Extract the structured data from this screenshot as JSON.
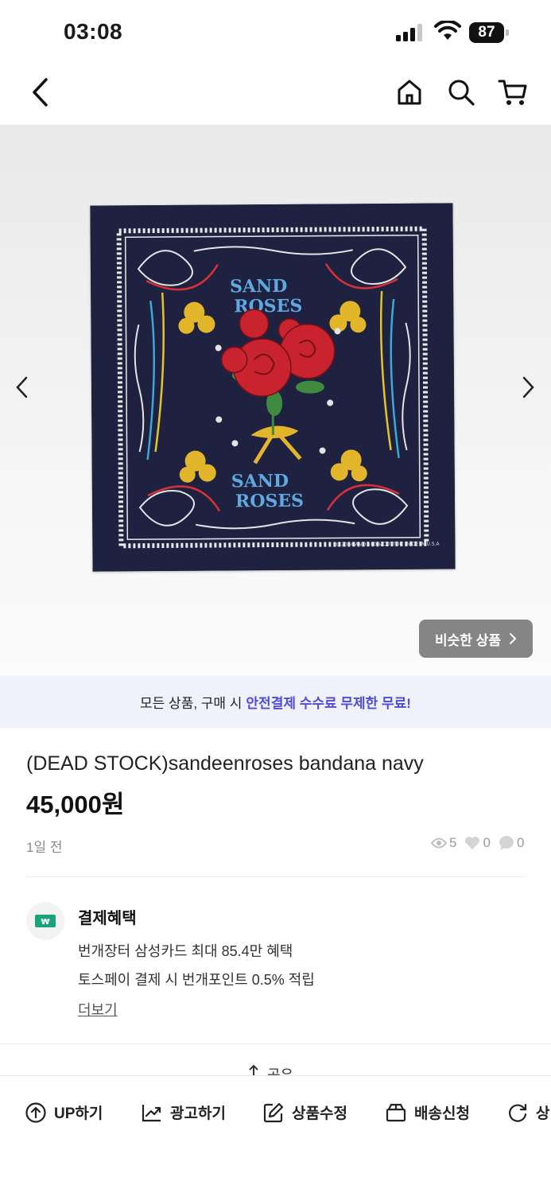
{
  "status_bar": {
    "time": "03:08",
    "battery": "87"
  },
  "nav": {
    "icons": [
      "back-icon",
      "home-icon",
      "search-icon",
      "cart-icon"
    ]
  },
  "gallery": {
    "similar_label": "비슷한 상품"
  },
  "promo": {
    "text": "모든 상품, 구매 시",
    "highlight": "안전결제 수수료 무제한 무료!"
  },
  "product": {
    "title": "(DEAD STOCK)sandeenroses bandana navy",
    "price": "45,000원",
    "posted": "1일 전",
    "views": "5",
    "likes": "0",
    "chats": "0"
  },
  "benefit": {
    "title": "결제혜택",
    "line1": "번개장터 삼성카드 최대 85.4만 혜택",
    "line2": "토스페이 결제 시 번개포인트 0.5% 적립",
    "more": "더보기"
  },
  "share": {
    "label": "공유"
  },
  "actions": [
    {
      "label": "UP하기",
      "icon": "up-icon"
    },
    {
      "label": "광고하기",
      "icon": "chart-icon"
    },
    {
      "label": "상품수정",
      "icon": "edit-icon"
    },
    {
      "label": "배송신청",
      "icon": "box-icon"
    },
    {
      "label": "상",
      "icon": "refresh-icon"
    }
  ],
  "colors": {
    "accent": "#4f4bd8",
    "promo_bg": "#eff1fb",
    "badge_green": "#1aa37a"
  }
}
